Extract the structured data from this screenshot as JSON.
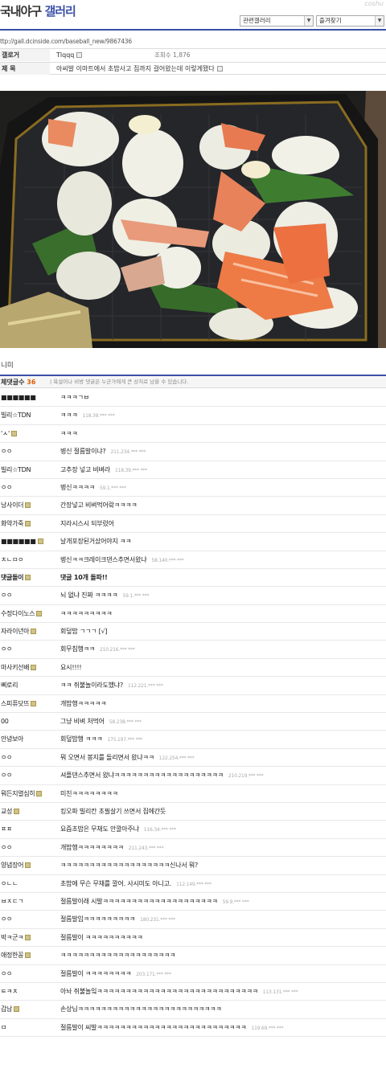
{
  "header": {
    "gallery_prefix": "국내야구",
    "gallery_highlight": "갤러리",
    "logo": "coshu",
    "select_related": "관련갤러리",
    "select_favorites": "즐겨찾기"
  },
  "url": "ttp://gall.dcinside.com/baseball_new/9867436",
  "post": {
    "writer_label": "갤로거",
    "writer": "Tlqqq",
    "views_label": "조회수",
    "views": "1,876",
    "subject_label": "제  목",
    "subject": "아씨발 이마트에서 초밥사고 집까지 걸어왔는데 이렇게됐다"
  },
  "caption": "니미",
  "comments_header": {
    "title": "체댓글수",
    "count": "36",
    "notice": "| 욕설이나 비방 댓글은 누군가에게 큰 상처로 남을 수 있습니다."
  },
  "comments": [
    {
      "nick": "■■■■■■",
      "text": "ㅋㅋㅋㄱㅂ",
      "ip": ""
    },
    {
      "nick": "빌리☆TDN",
      "text": "ㅋㅋㅋ",
      "ip": "118.39.*** ***"
    },
    {
      "nick": "'ㅅ'",
      "text": "ㅋㅋㅋ",
      "ip": ""
    },
    {
      "nick": "ㅇㅇ",
      "text": "병신 절름발이냐?",
      "ip": "211.234.*** ***"
    },
    {
      "nick": "빌리☆TDN",
      "text": "고추장 넣고 비벼라",
      "ip": "118.39.*** ***"
    },
    {
      "nick": "ㅇㅇ",
      "text": "병신ㅋㅋㅋㅋ",
      "ip": "59.1.*** ***"
    },
    {
      "nick": "낭사이더",
      "text": "간장넣고 비벼먹어랔ㅋㅋㅋㅋ",
      "ip": ""
    },
    {
      "nick": "화약가죽",
      "text": "지라시스시 되부렀어",
      "ip": ""
    },
    {
      "nick": "■■■■■■",
      "text": "날개포장된거샀어야지 ㅋㅋ",
      "ip": ""
    },
    {
      "nick": "ㅊㄴㅁㅇ",
      "text": "병신ㅋㅋ크레이크댄스추면서왔냐",
      "ip": "58.140.*** ***"
    },
    {
      "nick": "댓글돌이",
      "text": "댓글 10개 돌파!!",
      "ip": "",
      "bold": true
    },
    {
      "nick": "ㅇㅇ",
      "text": "뇌 없냐 진짜 ㅋㅋㅋㅋ",
      "ip": "59.1.*** ***"
    },
    {
      "nick": "수정다이노스",
      "text": "ㅋㅋㅋㅋㅋㅋㅋㅋㅋ",
      "ip": ""
    },
    {
      "nick": "자라이년아",
      "text": "회덮밥 ㄱㄱㄱ [√]",
      "ip": ""
    },
    {
      "nick": "ㅇㅇ",
      "text": "회무침행ㅋㅋ",
      "ip": "210.216.*** ***"
    },
    {
      "nick": "마사키선배",
      "text": "요시!!!!",
      "ip": ""
    },
    {
      "nick": "삐로리",
      "text": "ㅋㅋ 쥐불놀이라도했냐?",
      "ip": "112.221.*** ***"
    },
    {
      "nick": "스피퓨닷뜨",
      "text": "개밥행ㅋㅋㅋㅋㅋ",
      "ip": ""
    },
    {
      "nick": "00",
      "text": "그냥 비벼 처먹어",
      "ip": "58.238.*** ***"
    },
    {
      "nick": "안녕보아",
      "text": "회덮밥행 ㅋㅋㅋ",
      "ip": "175.197.*** ***"
    },
    {
      "nick": "ㅇㅇ",
      "text": "뭐 오면서 봉지를 돌리면서 왔냐ㅋㅋ",
      "ip": "122.254.*** ***"
    },
    {
      "nick": "ㅇㅇ",
      "text": "셔플댄스추면서 왔냐ㅋㅋㅋㅋㅋㅋㅋㅋㅋㅋㅋㅋㅋㅋㅋㅋㅋㅋㅋ",
      "ip": "210.219.*** ***"
    },
    {
      "nick": "뭐든지열심히",
      "text": "미친ㅋㅋㅋㅋㅋㅋㅋㅋ",
      "ip": ""
    },
    {
      "nick": "교성",
      "text": "킹오파 빌리칸 초필살기 쓰면서 집에간듯",
      "ip": ""
    },
    {
      "nick": "ㅍㅍ",
      "text": "요즘초밥은 무채도 안깔아주냐",
      "ip": "116.34.*** ***"
    },
    {
      "nick": "ㅇㅇ",
      "text": "개밥행ㅋㅋㅋㅋㅋㅋㅋㅋ",
      "ip": "211.243.*** ***"
    },
    {
      "nick": "양념장어",
      "text": "ㅋㅋㅋㅋㅋㅋㅋㅋㅋㅋㅋㅋㅋㅋㅋㅋㅋㅋㅋ신나서 뭐?",
      "ip": ""
    },
    {
      "nick": "ㅇㄴㄴ",
      "text": "초밥에 무슨 무채를 깔어. 사시미도 아니고.",
      "ip": "112.149.*** ***"
    },
    {
      "nick": "ㅂㅈㄷㄱ",
      "text": "절름발이래 시발ㅋㅋㅋㅋㅋㅋㅋㅋㅋㅋㅋㅋㅋㅋㅋㅋㅋㅋㅋㅋ",
      "ip": "59.9.*** ***"
    },
    {
      "nick": "ㅇㅇ",
      "text": "절름발임ㅋㅋㅋㅋㅋㅋㅋㅋㅋ",
      "ip": "180.231.*** ***"
    },
    {
      "nick": "박ㅋ군ㅋ",
      "text": "절름발이 ㅋㅋㅋㅋㅋㅋㅋㅋㅋㅋ",
      "ip": ""
    },
    {
      "nick": "애정한꽁",
      "text": "ㅋㅋㅋㅋㅋㅋㅋㅋㅋㅋㅋㅋㅋㅋㅋㅋㅋㅋㅋㅋ",
      "ip": ""
    },
    {
      "nick": "ㅇㅇ",
      "text": "절름발이 ㅋㅋㅋㅋㅋㅋㅋㅋ",
      "ip": "203.171.*** ***"
    },
    {
      "nick": "ㅌㅋㅊ",
      "text": "아놔 쥐불놀잌ㅋㅋㅋㅋㅋㅋㅋㅋㅋㅋㅋㅋㅋㅋㅋㅋㅋㅋㅋㅋㅋㅋㅋㅋㅋㅋㅋㅋ",
      "ip": "113.131.*** ***"
    },
    {
      "nick": "갑남",
      "text": "손상님ㅋㅋㅋㅋㅋㅋㅋㅋㅋㅋㅋㅋㅋㅋㅋㅋㅋㅋㅋㅋㅋㅋㅋㅋㅋ",
      "ip": ""
    },
    {
      "nick": "ㅁ",
      "text": "절름발이 씨발ㅋㅋㅋㅋㅋㅋㅋㅋㅋㅋㅋㅋㅋㅋㅋㅋㅋㅋㅋㅋㅋㅋㅋㅋㅋㅋ",
      "ip": "119.69.*** ***"
    }
  ]
}
